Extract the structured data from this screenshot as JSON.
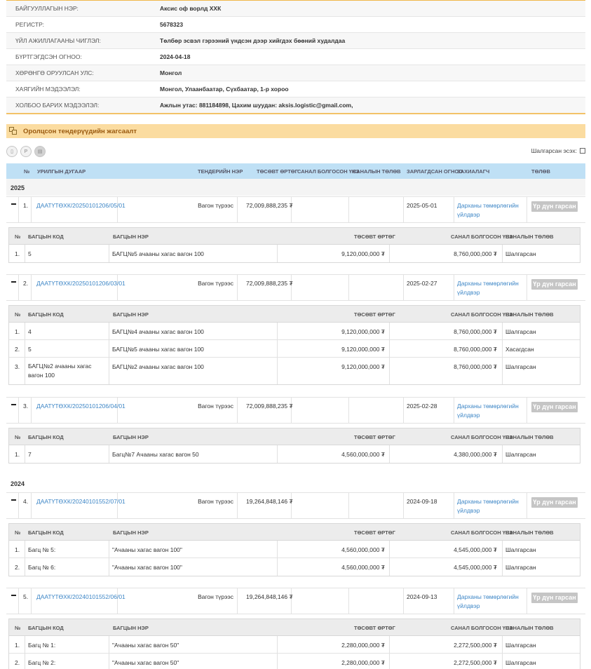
{
  "company": {
    "rows": [
      {
        "key": "БАЙГУУЛЛАГЫН НЭР:",
        "value": "Аксис оф ворлд ХХК"
      },
      {
        "key": "РЕГИСТР:",
        "value": "5678323"
      },
      {
        "key": "ҮЙЛ АЖИЛЛАГААНЫ ЧИГЛЭЛ:",
        "value": "Төлбөр эсвэл гэрээний үндсэн дээр хийгдэх бөөний худалдаа"
      },
      {
        "key": "БҮРТГЭГДСЭН ОГНОО:",
        "value": "2024-04-18"
      },
      {
        "key": "ХӨРӨНГӨ ОРУУЛСАН УЛС:",
        "value": "Монгол"
      },
      {
        "key": "ХАЯГИЙН МЭДЭЭЛЭЛ:",
        "value": "Монгол, Улаанбаатар, Сүхбаатар, 1-р хороо"
      },
      {
        "key": "ХОЛБОО БАРИХ МЭДЭЭЛЭЛ:",
        "value": "Ажлын утас: 88118489​8, Цахим шуудан: aksis.logistic@gmail.com,"
      }
    ]
  },
  "section": {
    "title": "Оролцсон тендерүүдийн жагсаалт"
  },
  "toolbar": {
    "lost_label": "Шалгарсан эсэх:"
  },
  "table": {
    "headers": {
      "no": "№",
      "code": "УРИЛГЫН ДУГААР",
      "name": "ТЕНДЕРИЙН НЭР",
      "budget": "ТӨСӨВТ ӨРТӨГ",
      "offer": "САНАЛ БОЛГОСОН ҮНЭ",
      "offer_status": "САНАЛЫН ТӨЛӨВ",
      "date": "ЗАРЛАГДСАН ОГНОО",
      "buyer": "ЗАХИАЛАГЧ",
      "status": "ТӨЛӨВ"
    },
    "sub_headers": {
      "no": "№",
      "lot_code": "БАГЦЫН КОД",
      "lot_name": "БАГЦЫН НЭР",
      "budget": "ТӨСӨВТ ӨРТӨГ",
      "offer": "САНАЛ БОЛГОСОН ҮНЭ",
      "offer_status": "САНАЛЫН ТӨЛӨВ"
    },
    "years": [
      "2025",
      "2024"
    ],
    "tenders": [
      {
        "num": "1.",
        "code": "ДААТҮТӨХК/20250101206/05/01",
        "name": "Вагон түрээс",
        "budget": "72,009,888,235 ₮",
        "date": "2025-05-01",
        "buyer": "Дарханы төмөрлөгийн үйлдвэр",
        "status": "Үр дүн гарсан",
        "lots": [
          {
            "num": "1.",
            "code": "5",
            "name": "БАГЦ№5 ачааны хагас вагон 100",
            "budget": "9,120,000,000 ₮",
            "offer": "8,760,000,000 ₮",
            "state": "Шалгарсан"
          }
        ]
      },
      {
        "num": "2.",
        "code": "ДААТҮТӨХК/20250101206/03/01",
        "name": "Вагон түрээс",
        "budget": "72,009,888,235 ₮",
        "date": "2025-02-27",
        "buyer": "Дарханы төмөрлөгийн үйлдвэр",
        "status": "Үр дүн гарсан",
        "lots": [
          {
            "num": "1.",
            "code": "4",
            "name": "БАГЦ№4 ачааны хагас вагон 100",
            "budget": "9,120,000,000 ₮",
            "offer": "8,760,000,000 ₮",
            "state": "Шалгарсан"
          },
          {
            "num": "2.",
            "code": "5",
            "name": "БАГЦ№5 ачааны хагас вагон 100",
            "budget": "9,120,000,000 ₮",
            "offer": "8,760,000,000 ₮",
            "state": "Хасагдсан"
          },
          {
            "num": "3.",
            "code": "БАГЦ№2 ачааны хагас вагон 100",
            "name": "БАГЦ№2 ачааны хагас вагон 100",
            "budget": "9,120,000,000 ₮",
            "offer": "8,760,000,000 ₮",
            "state": "Шалгарсан"
          }
        ]
      },
      {
        "num": "3.",
        "code": "ДААТҮТӨХК/20250101206/04/01",
        "name": "Вагон түрээс",
        "budget": "72,009,888,235 ₮",
        "date": "2025-02-28",
        "buyer": "Дарханы төмөрлөгийн үйлдвэр",
        "status": "Үр дүн гарсан",
        "lots": [
          {
            "num": "1.",
            "code": "7",
            "name": "Багц№7 Ачааны хагас вагон 50",
            "budget": "4,560,000,000 ₮",
            "offer": "4,380,000,000 ₮",
            "state": "Шалгарсан"
          }
        ]
      },
      {
        "num": "4.",
        "code": "ДААТҮТӨХК/20240101552/07/01",
        "name": "Вагон түрээс",
        "budget": "19,264,848,146 ₮",
        "date": "2024-09-18",
        "buyer": "Дарханы төмөрлөгийн үйлдвэр",
        "status": "Үр дүн гарсан",
        "lots": [
          {
            "num": "1.",
            "code": "Багц № 5:",
            "name": "\"Ачааны хагас вагон 100\"",
            "budget": "4,560,000,000 ₮",
            "offer": "4,545,000,000 ₮",
            "state": "Шалгарсан"
          },
          {
            "num": "2.",
            "code": "Багц № 6:",
            "name": "\"Ачааны хагас вагон 100\"",
            "budget": "4,560,000,000 ₮",
            "offer": "4,545,000,000 ₮",
            "state": "Шалгарсан"
          }
        ]
      },
      {
        "num": "5.",
        "code": "ДААТҮТӨХК/20240101552/06/01",
        "name": "Вагон түрээс",
        "budget": "19,264,848,146 ₮",
        "date": "2024-09-13",
        "buyer": "Дарханы төмөрлөгийн үйлдвэр",
        "status": "Үр дүн гарсан",
        "lots": [
          {
            "num": "1.",
            "code": "Багц № 1:",
            "name": "\"Ачааны хагас вагон 50\"",
            "budget": "2,280,000,000 ₮",
            "offer": "2,272,500,000 ₮",
            "state": "Шалгарсан"
          },
          {
            "num": "2.",
            "code": "Багц № 2:",
            "name": "\"Ачааны хагас вагон 50\"",
            "budget": "2,280,000,000 ₮",
            "offer": "2,272,500,000 ₮",
            "state": "Шалгарсан"
          }
        ]
      }
    ]
  }
}
